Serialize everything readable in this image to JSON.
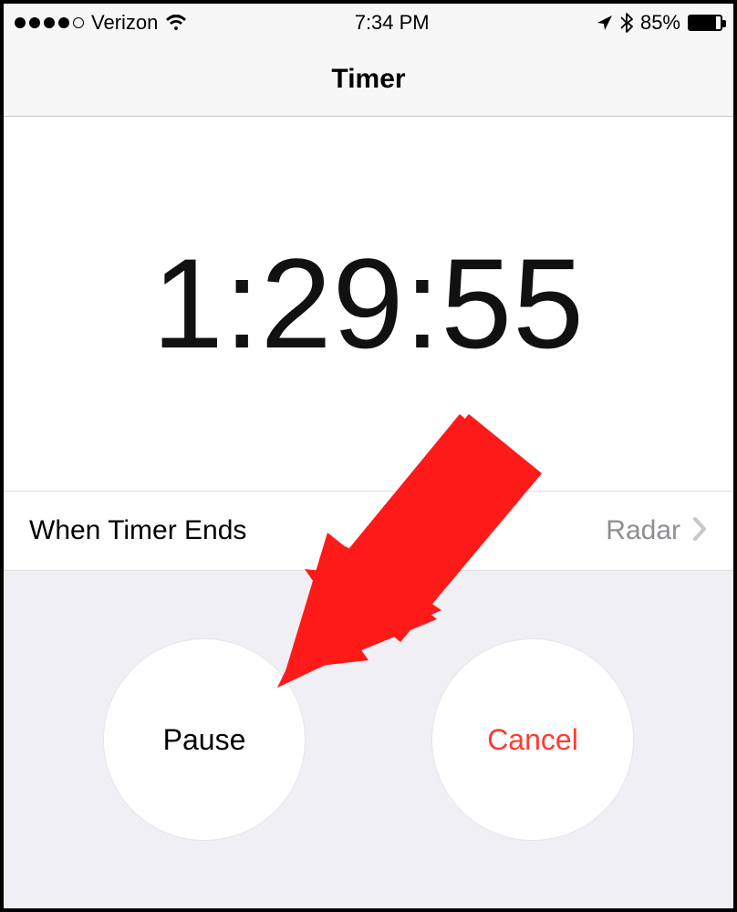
{
  "status": {
    "carrier": "Verizon",
    "time": "7:34 PM",
    "battery_percent": "85%",
    "battery_fill_percent": 85
  },
  "header": {
    "title": "Timer"
  },
  "timer": {
    "time": "1:29:55"
  },
  "when_ends": {
    "label": "When Timer Ends",
    "value": "Radar"
  },
  "buttons": {
    "pause_label": "Pause",
    "cancel_label": "Cancel"
  },
  "annotation": {
    "arrow_color": "#ff1a1a"
  }
}
